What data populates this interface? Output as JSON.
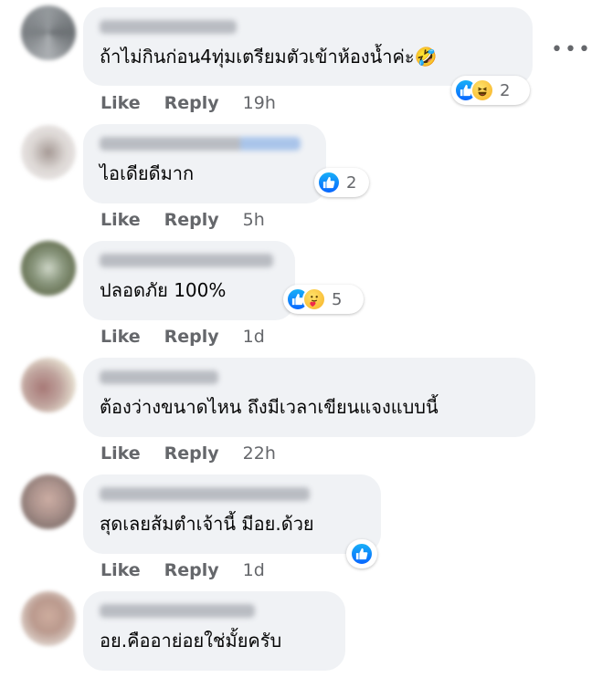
{
  "comments": [
    {
      "text": "ถ้าไม่กินก่อน4ทุ่มเตรียมตัวเข้าห้องน้ำค่ะ🤣",
      "reactions": [
        "like",
        "haha"
      ],
      "reaction_count": "2",
      "like_label": "Like",
      "reply_label": "Reply",
      "time": "19h"
    },
    {
      "text": "ไอเดียดีมาก",
      "reactions": [
        "like"
      ],
      "reaction_count": "2",
      "like_label": "Like",
      "reply_label": "Reply",
      "time": "5h"
    },
    {
      "text": "ปลอดภัย 100%",
      "reactions": [
        "like",
        "care"
      ],
      "reaction_count": "5",
      "like_label": "Like",
      "reply_label": "Reply",
      "time": "1d"
    },
    {
      "text": "ต้องว่างขนาดไหน ถึงมีเวลาเขียนแจงแบบนี้",
      "reactions": [],
      "reaction_count": "",
      "like_label": "Like",
      "reply_label": "Reply",
      "time": "22h"
    },
    {
      "text": "สุดเลยส้มตำเจ้านี้ มีอย.ด้วย",
      "reactions": [
        "like"
      ],
      "reaction_count": "",
      "like_label": "Like",
      "reply_label": "Reply",
      "time": "1d"
    },
    {
      "text": "อย.คืออาย่อยใช่มั้ยครับ",
      "reactions": [],
      "reaction_count": "",
      "like_label": "",
      "reply_label": "",
      "time": ""
    }
  ],
  "more_icon": "more-horizontal-icon",
  "colors": {
    "bubble": "#f0f2f5",
    "meta_text": "#65676b",
    "like_blue": "#0866ff",
    "reaction_yellow": "#f7b125"
  }
}
